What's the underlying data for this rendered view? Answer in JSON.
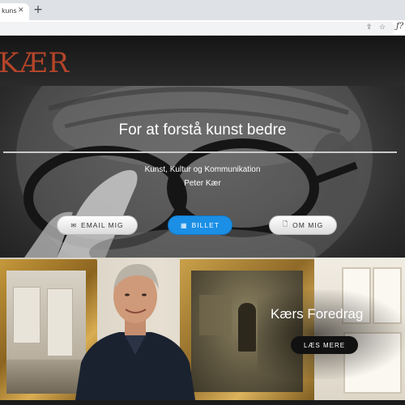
{
  "browser": {
    "tab_title": "kuns",
    "tab_close_icon": "close-icon",
    "new_tab_icon": "plus-icon",
    "share_icon": "share-icon",
    "star_icon": "star-icon",
    "extension_label": "ƒ?"
  },
  "header": {
    "logo_text": "KÆR"
  },
  "hero": {
    "title": "For at forstå kunst bedre",
    "subtitle_line1": "Kunst, Kultur og Kommunikation",
    "subtitle_line2": "Peter Kær",
    "buttons": [
      {
        "label": "EMAIL MIG",
        "icon": "envelope-icon"
      },
      {
        "label": "BILLET",
        "icon": "calendar-icon"
      },
      {
        "label": "OM MIG",
        "icon": "document-icon"
      }
    ]
  },
  "feature": {
    "title": "Kærs Foredrag",
    "button_label": "LÆS MERE"
  },
  "colors": {
    "logo": "#b5452a",
    "primary_button": "#1b8fe6",
    "tab_bar": "#dee1e6"
  }
}
